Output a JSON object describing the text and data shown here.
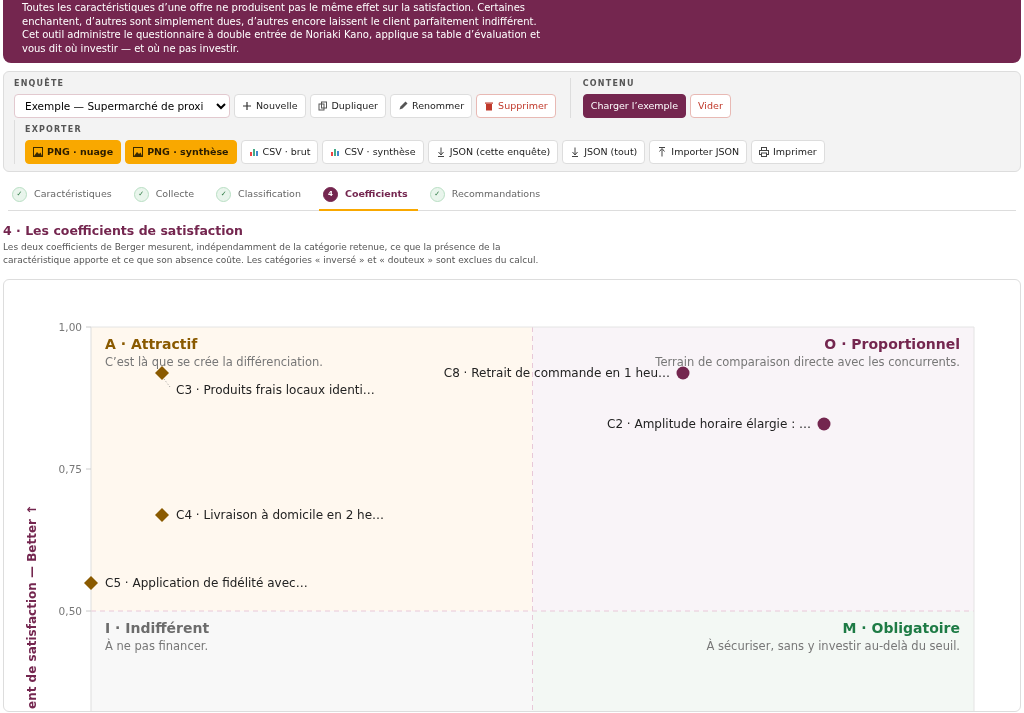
{
  "intro": {
    "lines": [
      "Toutes les caractéristiques d’une offre ne produisent pas le même effet sur la satisfaction. Certaines",
      "enchantent, d’autres sont simplement dues, d’autres encore laissent le client parfaitement indifférent.",
      "Cet outil administre le questionnaire à double entrée de Noriaki Kano, applique sa table d’évaluation et",
      "vous dit où investir — et où ne pas investir."
    ]
  },
  "toolbar": {
    "survey": {
      "heading": "ENQUÊTE",
      "select_value": "Exemple — Supermarché de proxi",
      "buttons": [
        {
          "label": "Nouvelle",
          "kind": "add"
        },
        {
          "label": "Dupliquer",
          "kind": "copy"
        },
        {
          "label": "Renommer",
          "kind": "rename"
        },
        {
          "label": "Supprimer",
          "kind": "delete"
        }
      ]
    },
    "content": {
      "heading": "CONTENU",
      "buttons": [
        {
          "label": "Charger l’exemple",
          "kind": "load"
        },
        {
          "label": "Vider",
          "kind": "clear"
        }
      ]
    },
    "export": {
      "heading": "EXPORTER",
      "buttons": [
        {
          "label": "PNG · nuage",
          "kind": "png"
        },
        {
          "label": "PNG · synthèse",
          "kind": "png"
        },
        {
          "label": "CSV · brut",
          "kind": "csv"
        },
        {
          "label": "CSV · synthèse",
          "kind": "csv"
        },
        {
          "label": "JSON (cette enquête)",
          "kind": "download"
        },
        {
          "label": "JSON (tout)",
          "kind": "download"
        },
        {
          "label": "Importer JSON",
          "kind": "upload"
        },
        {
          "label": "Imprimer",
          "kind": "print"
        }
      ]
    }
  },
  "tabs": [
    {
      "marker": "✓",
      "label": "Caractéristiques",
      "selected": false
    },
    {
      "marker": "✓",
      "label": "Collecte",
      "selected": false
    },
    {
      "marker": "✓",
      "label": "Classification",
      "selected": false
    },
    {
      "marker": "4",
      "label": "Coefficients",
      "selected": true
    },
    {
      "marker": "✓",
      "label": "Recommandations",
      "selected": false
    }
  ],
  "section": {
    "title": "4 · Les coefficients de satisfaction",
    "description": "Les deux coefficients de Berger mesurent, indépendamment de la catégorie retenue, ce que la présence de la caractéristique apporte et ce que son absence coûte. Les catégories « inversé » et « douteux » sont exclues du calcul."
  },
  "plot": {
    "y_axis_title": "ent de satisfaction — Better ↑",
    "y_ticks": [
      "1,00",
      "0,75",
      "0,50"
    ],
    "quadrants": [
      {
        "kind": "attractive",
        "title": "A · Attractif",
        "note": "C’est là que se crée la différenciation."
      },
      {
        "kind": "proportional",
        "title": "O · Proportionnel",
        "note": "Terrain de comparaison directe avec les concurrents."
      },
      {
        "kind": "indifferent",
        "title": "I · Indifférent",
        "note": "À ne pas financer."
      },
      {
        "kind": "mandatory",
        "title": "M · Obligatoire",
        "note": "À sécuriser, sans y investir au-delà du seuil."
      }
    ],
    "points": [
      {
        "kind": "attractive",
        "label": "C3 · Produits frais locaux identi…"
      },
      {
        "kind": "attractive",
        "label": "C4 · Livraison à domicile en 2 he…"
      },
      {
        "kind": "attractive",
        "label": "C5 · Application de fidélité avec…"
      },
      {
        "kind": "proportional",
        "label": "C8 · Retrait de commande en 1 heu…"
      },
      {
        "kind": "proportional",
        "label": "C2 · Amplitude horaire élargie : …"
      }
    ]
  }
}
